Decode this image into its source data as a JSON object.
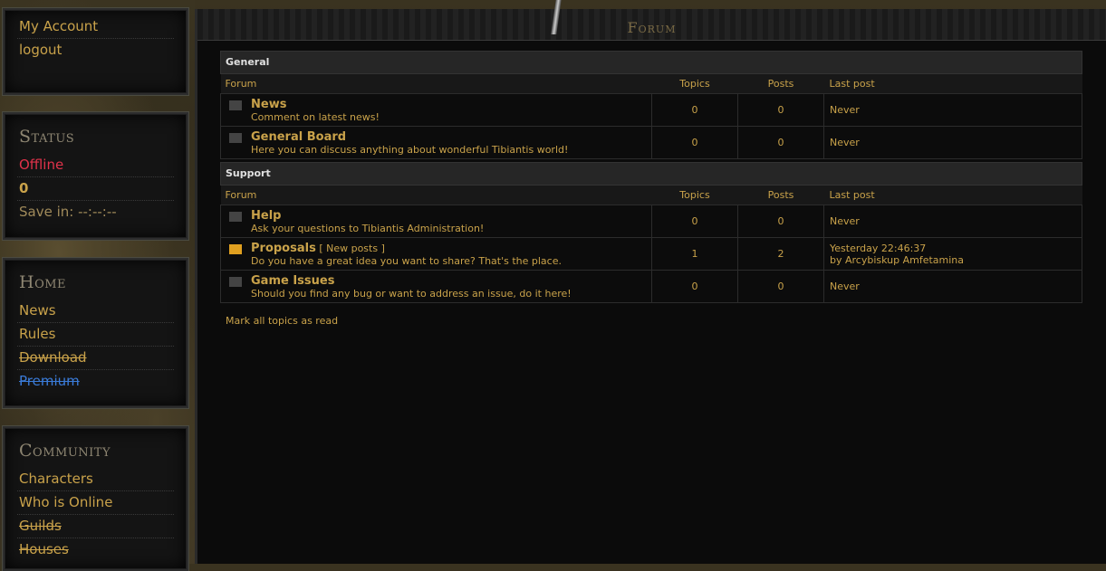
{
  "account": {
    "my_account": "My Account",
    "logout": "logout"
  },
  "status": {
    "title": "Status",
    "state": "Offline",
    "value": "0",
    "save": "Save in: --:--:--"
  },
  "home": {
    "title": "Home",
    "items": [
      "News",
      "Rules",
      "Download",
      "Premium"
    ]
  },
  "community": {
    "title": "Community",
    "items": [
      "Characters",
      "Who is Online",
      "Guilds",
      "Houses"
    ]
  },
  "forum": {
    "title": "Forum",
    "columns": {
      "forum": "Forum",
      "topics": "Topics",
      "posts": "Posts",
      "last_post": "Last post"
    },
    "categories": [
      {
        "name": "General",
        "forums": [
          {
            "name": "News",
            "desc": "Comment on latest news!",
            "topics": "0",
            "posts": "0",
            "last": "Never",
            "last2": "",
            "new": ""
          },
          {
            "name": "General Board",
            "desc": "Here you can discuss anything about wonderful Tibiantis world!",
            "topics": "0",
            "posts": "0",
            "last": "Never",
            "last2": "",
            "new": ""
          }
        ]
      },
      {
        "name": "Support",
        "forums": [
          {
            "name": "Help",
            "desc": "Ask your questions to Tibiantis Administration!",
            "topics": "0",
            "posts": "0",
            "last": "Never",
            "last2": "",
            "new": ""
          },
          {
            "name": "Proposals",
            "desc": "Do you have a great idea you want to share? That's the place.",
            "topics": "1",
            "posts": "2",
            "last": "Yesterday 22:46:37",
            "last2": "by Arcybiskup Amfetamina",
            "new": "[ New posts ]"
          },
          {
            "name": "Game Issues",
            "desc": "Should you find any bug or want to address an issue, do it here!",
            "topics": "0",
            "posts": "0",
            "last": "Never",
            "last2": "",
            "new": ""
          }
        ]
      }
    ],
    "mark_all": "Mark all topics as read"
  }
}
